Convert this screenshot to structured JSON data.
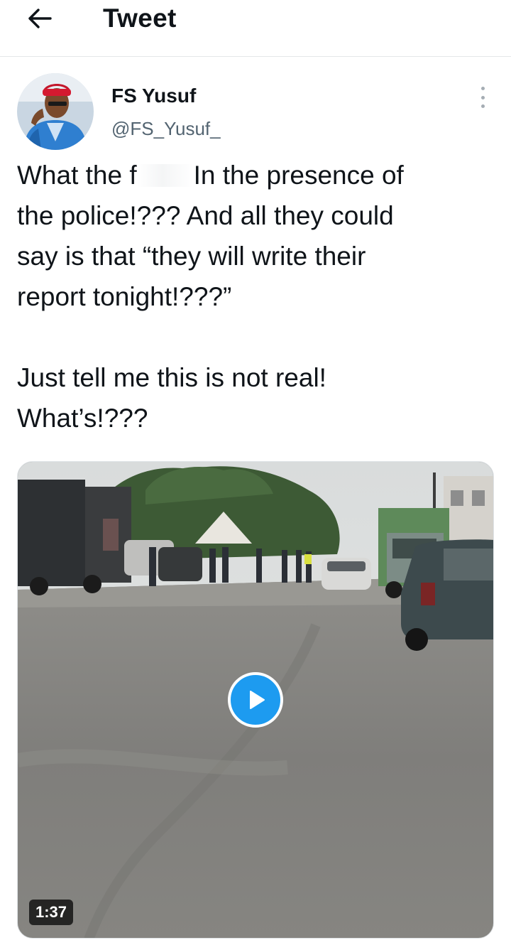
{
  "header": {
    "back_icon": "arrow-left-icon",
    "title": "Tweet"
  },
  "tweet": {
    "author": {
      "name": "FS Yusuf",
      "handle": "@FS_Yusuf_",
      "avatar_icon": "user-avatar"
    },
    "more_icon": "more-vertical-icon",
    "text": {
      "line1_before": "What the f",
      "line1_after": "In the presence of",
      "rest_paragraph1": "the police!??? And all they could\nsay is that “they will write their\nreport tonight!???”",
      "paragraph2": "Just tell me this is not real!\nWhat’s!???"
    },
    "media": {
      "type": "video",
      "duration": "1:37",
      "play_icon": "play-icon"
    }
  },
  "colors": {
    "accent": "#1d9bf0",
    "text_primary": "#0f1419",
    "text_secondary": "#536471",
    "divider": "#e4e7e9"
  }
}
